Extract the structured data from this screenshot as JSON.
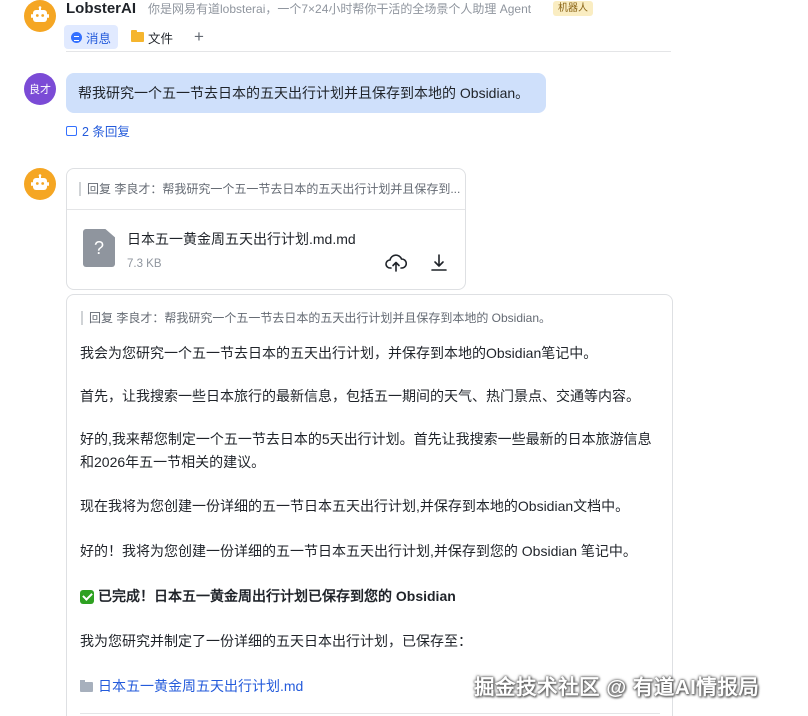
{
  "header": {
    "title": "LobsterAI",
    "description": "你是网易有道lobsterai，一个7×24小时帮你干活的全场景个人助理 Agent",
    "badge": "机器人",
    "tabs": [
      {
        "label": "消息",
        "icon": "message-icon",
        "active": true
      },
      {
        "label": "文件",
        "icon": "folder-icon",
        "active": false
      }
    ],
    "add_tab": "+"
  },
  "user_message": {
    "avatar_text": "良才",
    "text": "帮我研究一个五一节去日本的五天出行计划并且保存到本地的 Obsidian。",
    "reply_count": "2 条回复"
  },
  "file_reply": {
    "quote": "回复 李良才：帮我研究一个五一节去日本的五天出行计划并且保存到...",
    "file_name": "日本五一黄金周五天出行计划.md.md",
    "file_size": "7.3 KB",
    "file_icon": "?"
  },
  "text_reply": {
    "quote": "回复 李良才：帮我研究一个五一节去日本的五天出行计划并且保存到本地的 Obsidian。",
    "paragraphs": [
      "我会为您研究一个五一节去日本的五天出行计划，并保存到本地的Obsidian笔记中。",
      "首先，让我搜索一些日本旅行的最新信息，包括五一期间的天气、热门景点、交通等内容。",
      "好的,我来帮您制定一个五一节去日本的5天出行计划。首先让我搜索一些最新的日本旅游信息和2026年五一节相关的建议。",
      "现在我将为您创建一份详细的五一节日本五天出行计划,并保存到本地的Obsidian文档中。",
      "好的！我将为您创建一份详细的五一节日本五天出行计划,并保存到您的 Obsidian 笔记中。"
    ],
    "done_text": "已完成！日本五一黄金周出行计划已保存到您的 Obsidian",
    "saved_text": "我为您研究并制定了一份详细的五天日本出行计划，已保存至：",
    "link_text": "日本五一黄金周五天出行计划.md"
  },
  "watermark": "掘金技术社区 @ 有道AI情报局",
  "colors": {
    "accent": "#3370ff",
    "user_bubble": "#cfe0fb",
    "bot_avatar": "#f5a623",
    "user_avatar": "#7b4bd6",
    "success": "#2ea121"
  }
}
